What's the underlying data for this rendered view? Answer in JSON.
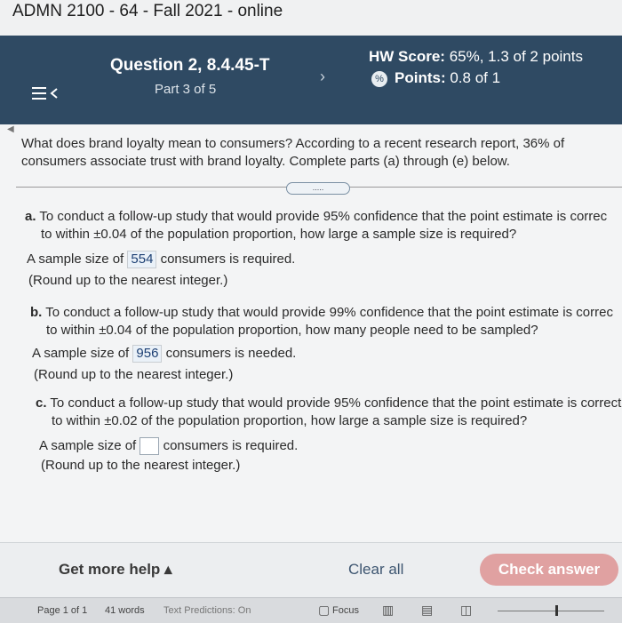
{
  "window": {
    "title": "ADMN 2100 - 64 - Fall 2021 - online"
  },
  "header": {
    "question_title": "Question 2, 8.4.45-T",
    "part": "Part 3 of 5",
    "hw_score_label": "HW Score:",
    "hw_score_value": "65%, 1.3 of 2 points",
    "points_label": "Points:",
    "points_value": "0.8 of 1",
    "menu_icon": "hamburger-back-icon",
    "next_icon": "chevron-right-icon",
    "points_icon": "partial-credit-icon"
  },
  "question": {
    "intro": "What does brand loyalty mean to consumers? According to a recent research report, 36% of consumers associate trust with brand loyalty. Complete parts (a) through (e) below.",
    "more_button": ".....",
    "parts": [
      {
        "letter": "a.",
        "line1": "To conduct a follow-up study that would provide 95% confidence that the point estimate is correc",
        "line2": "to within ±0.04 of the population proportion, how large a sample size is required?",
        "answer_prefix": "A sample size of",
        "answer_value": "554",
        "answer_suffix": "consumers is required.",
        "hint": "(Round up to the nearest integer.)"
      },
      {
        "letter": "b.",
        "line1": "To conduct a follow-up study that would provide 99% confidence that the point estimate is correc",
        "line2": "to within ±0.04 of the population proportion, how many people need to be sampled?",
        "answer_prefix": "A sample size of",
        "answer_value": "956",
        "answer_suffix": "consumers is needed.",
        "hint": "(Round up to the nearest integer.)"
      },
      {
        "letter": "c.",
        "line1": "To conduct a follow-up study that would provide 95% confidence that the point estimate is correct",
        "line2": "to within ±0.02 of the population proportion, how large a sample size is required?",
        "answer_prefix": "A sample size of",
        "answer_value": "",
        "answer_suffix": "consumers is required.",
        "hint": "(Round up to the nearest integer.)"
      }
    ]
  },
  "footer": {
    "help": "Get more help ▴",
    "clear": "Clear all",
    "check": "Check answer"
  },
  "status_bar": {
    "page": "Page 1 of 1",
    "words": "41 words",
    "text_predictions": "Text Predictions: On",
    "focus": "Focus"
  },
  "colors": {
    "banner": "#2f4a63",
    "check_button": "#e0a1a1",
    "answer_text": "#1c3f73"
  }
}
